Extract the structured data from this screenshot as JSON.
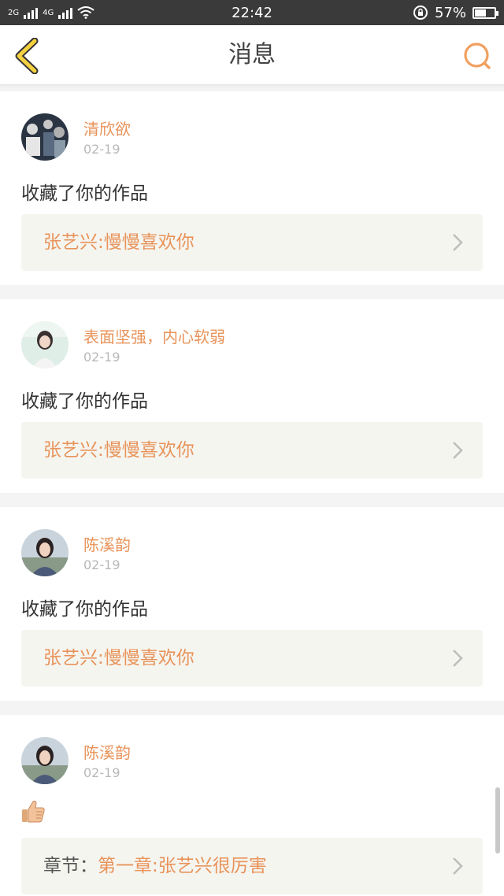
{
  "status_bar": {
    "network_label_1": "2G",
    "network_label_2": "4G",
    "time": "22:42",
    "battery": "57%",
    "battery_level": 0.57
  },
  "nav": {
    "title": "消息",
    "back_icon": "back-chevron-icon",
    "search_icon": "search-icon"
  },
  "colors": {
    "accent": "#e8935a",
    "back_arrow": "#f5d142"
  },
  "messages": [
    {
      "user": "清欣欲",
      "date": "02-19",
      "action": "收藏了你的作品",
      "work_prefix": "",
      "work_title": "张艺兴:慢慢喜欢你"
    },
    {
      "user": "表面坚强，内心软弱",
      "date": "02-19",
      "action": "收藏了你的作品",
      "work_prefix": "",
      "work_title": "张艺兴:慢慢喜欢你"
    },
    {
      "user": "陈溪韵",
      "date": "02-19",
      "action": "收藏了你的作品",
      "work_prefix": "",
      "work_title": "张艺兴:慢慢喜欢你"
    },
    {
      "user": "陈溪韵",
      "date": "02-19",
      "action_icon": "thumbs-up-icon",
      "work_prefix": "章节：",
      "work_title": "第一章:张艺兴很厉害"
    }
  ]
}
